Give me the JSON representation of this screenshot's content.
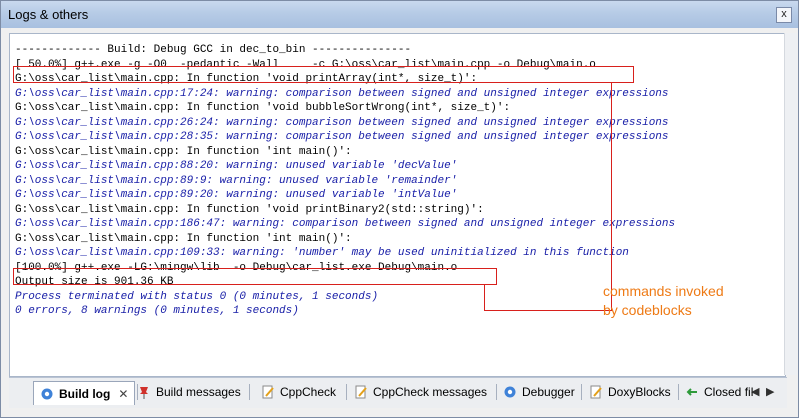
{
  "window": {
    "title": "Logs & others",
    "close_glyph": "x"
  },
  "log": {
    "lines": [
      {
        "type": "normal",
        "text": "------------- Build: Debug GCC in dec_to_bin ---------------"
      },
      {
        "type": "normal",
        "text": "[ 50.0%] g++.exe -g -O0  -pedantic -Wall     -c G:\\oss\\car_list\\main.cpp -o Debug\\main.o"
      },
      {
        "type": "normal",
        "text": "G:\\oss\\car_list\\main.cpp: In function 'void printArray(int*, size_t)':"
      },
      {
        "type": "warn",
        "text": "G:\\oss\\car_list\\main.cpp:17:24: warning: comparison between signed and unsigned integer expressions"
      },
      {
        "type": "normal",
        "text": "G:\\oss\\car_list\\main.cpp: In function 'void bubbleSortWrong(int*, size_t)':"
      },
      {
        "type": "warn",
        "text": "G:\\oss\\car_list\\main.cpp:26:24: warning: comparison between signed and unsigned integer expressions"
      },
      {
        "type": "warn",
        "text": "G:\\oss\\car_list\\main.cpp:28:35: warning: comparison between signed and unsigned integer expressions"
      },
      {
        "type": "normal",
        "text": "G:\\oss\\car_list\\main.cpp: In function 'int main()':"
      },
      {
        "type": "warn",
        "text": "G:\\oss\\car_list\\main.cpp:88:20: warning: unused variable 'decValue'"
      },
      {
        "type": "warn",
        "text": "G:\\oss\\car_list\\main.cpp:89:9: warning: unused variable 'remainder'"
      },
      {
        "type": "warn",
        "text": "G:\\oss\\car_list\\main.cpp:89:20: warning: unused variable 'intValue'"
      },
      {
        "type": "normal",
        "text": "G:\\oss\\car_list\\main.cpp: In function 'void printBinary2(std::string)':"
      },
      {
        "type": "warn",
        "text": "G:\\oss\\car_list\\main.cpp:186:47: warning: comparison between signed and unsigned integer expressions"
      },
      {
        "type": "normal",
        "text": "G:\\oss\\car_list\\main.cpp: In function 'int main()':"
      },
      {
        "type": "warn",
        "text": "G:\\oss\\car_list\\main.cpp:109:33: warning: 'number' may be used uninitialized in this function"
      },
      {
        "type": "normal",
        "text": "[100.0%] g++.exe -LG:\\mingw\\lib  -o Debug\\car_list.exe Debug\\main.o"
      },
      {
        "type": "normal",
        "text": "Output size is 901.36 KB"
      },
      {
        "type": "blue",
        "text": "Process terminated with status 0 (0 minutes, 1 seconds)"
      },
      {
        "type": "blue",
        "text": "0 errors, 8 warnings (0 minutes, 1 seconds)"
      }
    ]
  },
  "annotation": {
    "line1": "commands invoked",
    "line2": "by codeblocks",
    "color": "#ee7a15"
  },
  "tabs": [
    {
      "label": "Build log",
      "active": true,
      "icon": "gear-icon"
    },
    {
      "label": "Build messages",
      "icon": "pin-icon"
    },
    {
      "label": "CppCheck",
      "icon": "pencil-icon"
    },
    {
      "label": "CppCheck messages",
      "icon": "pencil-icon"
    },
    {
      "label": "Debugger",
      "icon": "gear-icon"
    },
    {
      "label": "DoxyBlocks",
      "icon": "pencil-icon"
    },
    {
      "label": "Closed fil",
      "icon": "back-arrow-icon"
    }
  ],
  "colors": {
    "highlight_box": "#d8201c",
    "warning_text": "#1a20a8"
  }
}
